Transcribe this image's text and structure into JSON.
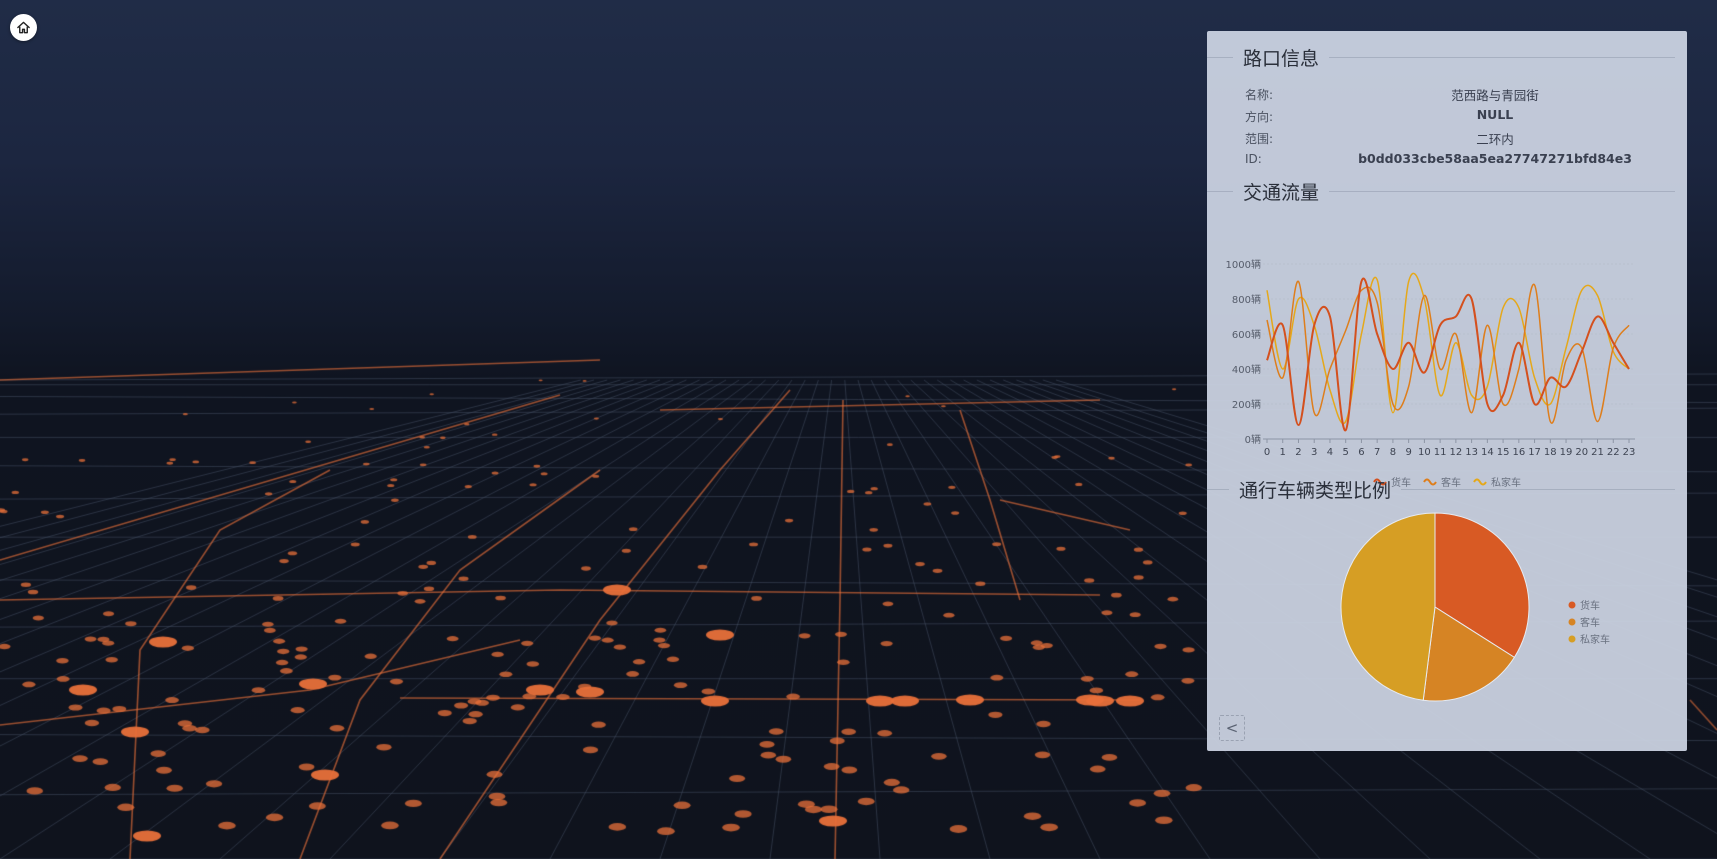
{
  "map": {
    "marker_color": "#e8703a"
  },
  "home_icon": "home-icon",
  "panel": {
    "intersection_title": "路口信息",
    "info": [
      {
        "key": "名称:",
        "value": "范西路与青园街",
        "bold": false
      },
      {
        "key": "方向:",
        "value": "NULL",
        "bold": true
      },
      {
        "key": "范围:",
        "value": "二环内",
        "bold": false
      },
      {
        "key": "ID:",
        "value": "b0dd033cbe58aa5ea27747271bfd84e3",
        "bold": true
      }
    ],
    "traffic_title": "交通流量",
    "vehicle_ratio_title": "通行车辆类型比例",
    "collapse_label": "<"
  },
  "chart_data": [
    {
      "type": "line",
      "x": [
        "0",
        "1",
        "2",
        "3",
        "4",
        "5",
        "6",
        "7",
        "8",
        "9",
        "10",
        "11",
        "12",
        "13",
        "14",
        "15",
        "16",
        "17",
        "18",
        "19",
        "20",
        "21",
        "22",
        "23"
      ],
      "ylim": [
        0,
        1000
      ],
      "yticks": [
        "0辆",
        "200辆",
        "400辆",
        "600辆",
        "800辆",
        "1000辆"
      ],
      "legend_position": "bottom",
      "series": [
        {
          "name": "货车",
          "color": "#d4501e",
          "values": [
            450,
            650,
            80,
            650,
            700,
            50,
            900,
            600,
            400,
            550,
            380,
            650,
            700,
            800,
            200,
            250,
            550,
            200,
            350,
            300,
            500,
            700,
            550,
            400
          ]
        },
        {
          "name": "客车",
          "color": "#de7e1c",
          "values": [
            680,
            350,
            900,
            150,
            400,
            620,
            850,
            780,
            200,
            300,
            820,
            400,
            600,
            150,
            650,
            200,
            400,
            880,
            100,
            450,
            520,
            100,
            520,
            650
          ]
        },
        {
          "name": "私家车",
          "color": "#e5a81a",
          "values": [
            850,
            400,
            800,
            650,
            280,
            100,
            600,
            910,
            150,
            900,
            800,
            250,
            550,
            250,
            300,
            750,
            750,
            350,
            200,
            520,
            850,
            820,
            500,
            400
          ]
        }
      ]
    },
    {
      "type": "pie",
      "legend_position": "right",
      "slices": [
        {
          "name": "货车",
          "value": 34,
          "color": "#d85a24"
        },
        {
          "name": "客车",
          "value": 18,
          "color": "#d68424"
        },
        {
          "name": "私家车",
          "value": 48,
          "color": "#d69e24"
        }
      ]
    }
  ]
}
